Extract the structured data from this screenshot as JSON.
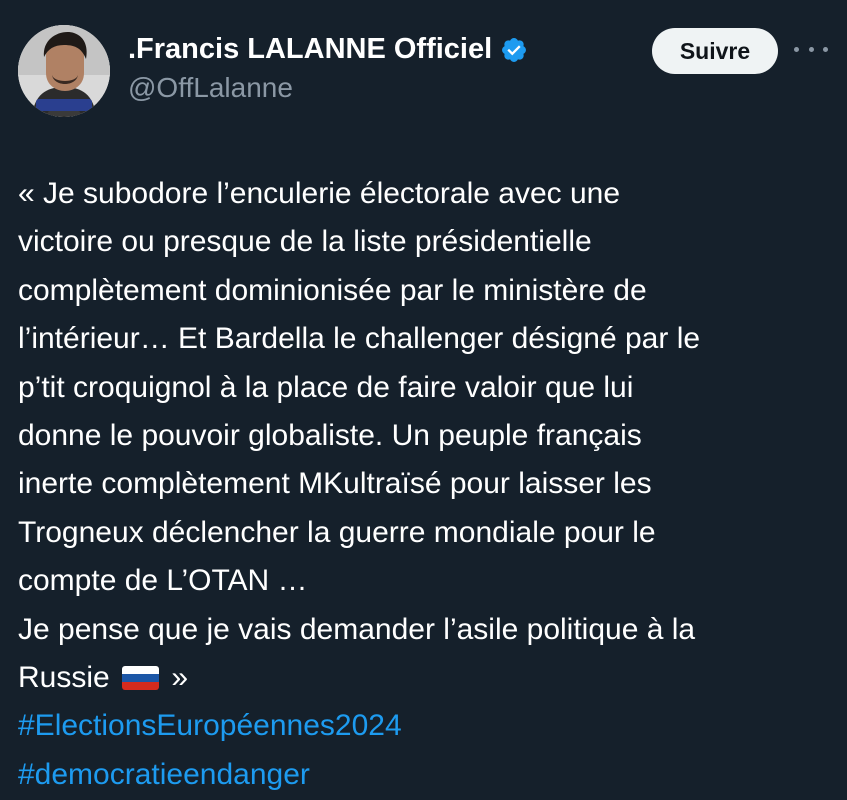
{
  "author": {
    "display_name": ".Francis LALANNE Officiel",
    "handle": "@OffLalanne",
    "avatar_icon": "profile-photo",
    "verified_icon": "verified-badge-icon",
    "verified_color": "#1d9bf0"
  },
  "actions": {
    "follow_label": "Suivre",
    "more_icon": "more-horizontal-icon"
  },
  "tweet": {
    "lines": [
      "« Je subodore l’enculerie électorale avec une",
      "victoire ou presque de la liste présidentielle",
      "complètement dominionisée par le ministère de",
      "l’intérieur… Et Bardella le challenger désigné par le",
      "p’tit croquignol à la place de faire valoir que lui",
      "donne le pouvoir globaliste. Un peuple français",
      "inerte complètement MKultraïsé pour laisser les",
      "Trogneux déclencher la guerre mondiale pour le",
      "compte de L’OTAN …",
      "Je pense que je vais demander l’asile politique à la"
    ],
    "last_line_before_flag": "Russie",
    "flag_icon": "russia-flag-icon",
    "last_line_after_flag": "»",
    "hashtags": [
      "#ElectionsEuropéennes2024",
      "#democratieendanger"
    ]
  },
  "colors": {
    "background": "#15202b",
    "text": "#ffffff",
    "secondary_text": "#8b98a5",
    "link": "#1d9bf0",
    "follow_button_bg": "#eff3f4"
  }
}
